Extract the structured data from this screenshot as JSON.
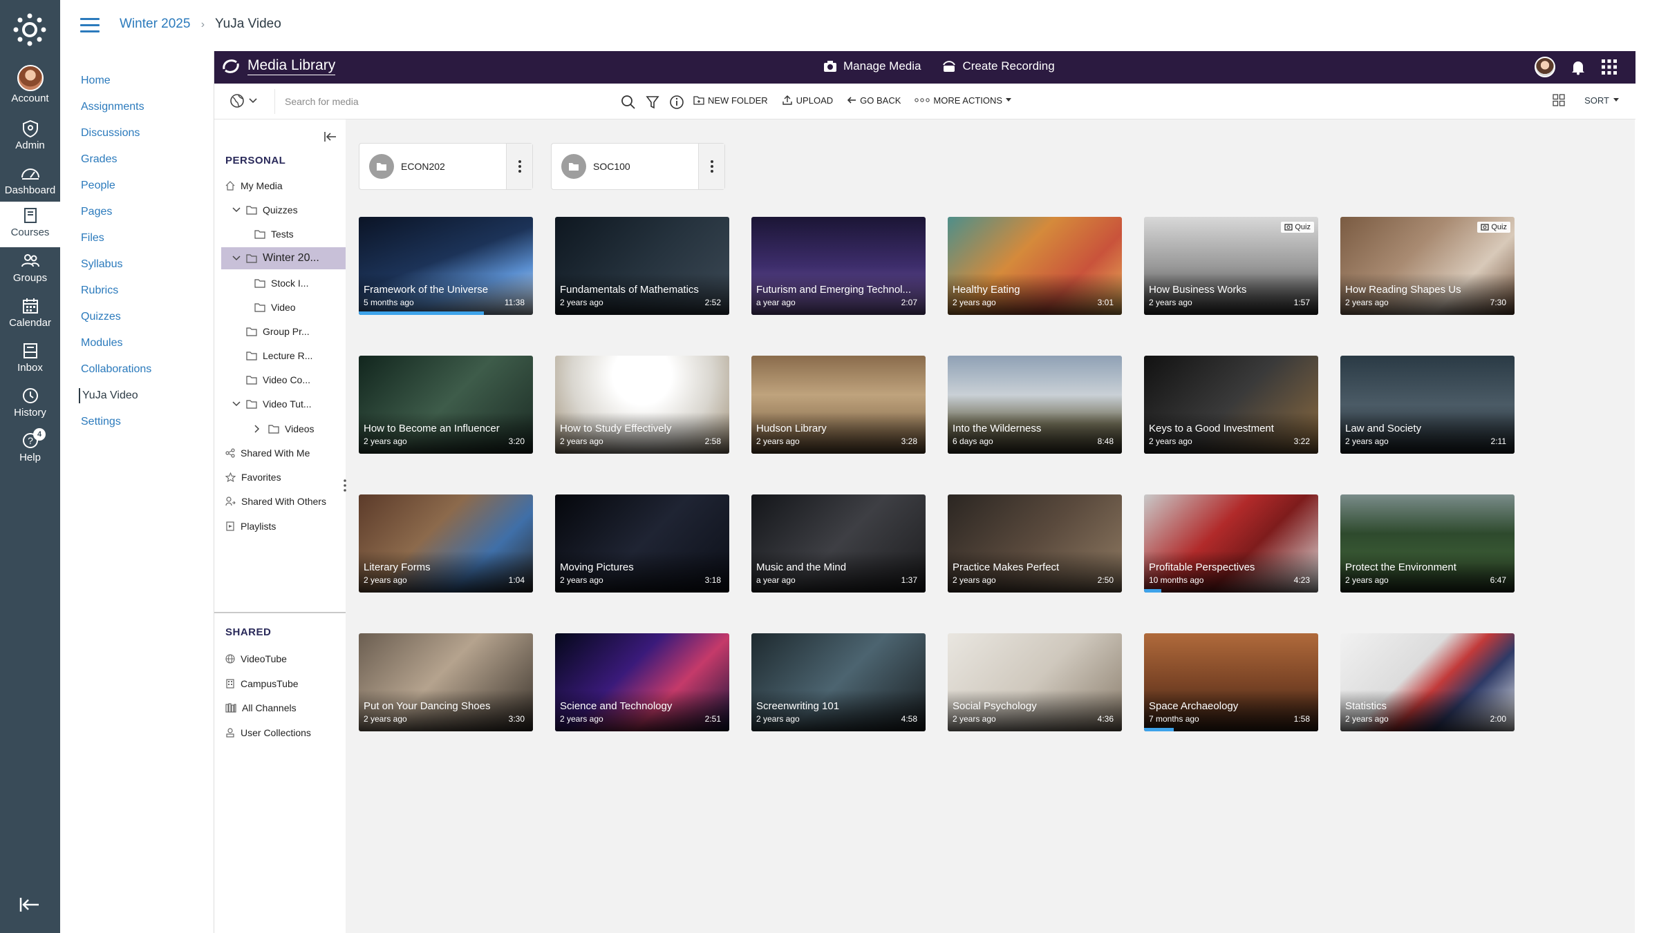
{
  "global_nav": {
    "items": [
      {
        "label": "Account",
        "icon": "account-avatar"
      },
      {
        "label": "Admin",
        "icon": "shield-icon"
      },
      {
        "label": "Dashboard",
        "icon": "dashboard-icon"
      },
      {
        "label": "Courses",
        "icon": "book-icon",
        "active": true
      },
      {
        "label": "Groups",
        "icon": "groups-icon"
      },
      {
        "label": "Calendar",
        "icon": "calendar-icon"
      },
      {
        "label": "Inbox",
        "icon": "inbox-icon"
      },
      {
        "label": "History",
        "icon": "clock-icon"
      },
      {
        "label": "Help",
        "icon": "help-icon",
        "badge": "4"
      }
    ]
  },
  "breadcrumb": {
    "course": "Winter 2025",
    "page": "YuJa Video"
  },
  "course_nav": [
    "Home",
    "Assignments",
    "Discussions",
    "Grades",
    "People",
    "Pages",
    "Files",
    "Syllabus",
    "Rubrics",
    "Quizzes",
    "Modules",
    "Collaborations",
    "YuJa Video",
    "Settings"
  ],
  "course_nav_active": "YuJa Video",
  "yuja": {
    "title": "Media Library",
    "manage_media": "Manage Media",
    "create_recording": "Create Recording",
    "search_placeholder": "Search for media",
    "actions": {
      "new_folder": "NEW FOLDER",
      "upload": "UPLOAD",
      "go_back": "GO BACK",
      "more_actions": "MORE ACTIONS"
    },
    "sort": "SORT",
    "accent_color": "#2b1a40",
    "progress_color": "#3ea3ea"
  },
  "tree": {
    "personal_heading": "PERSONAL",
    "shared_heading": "SHARED",
    "personal": [
      {
        "label": "My Media",
        "icon": "home-icon"
      },
      {
        "label": "Quizzes",
        "icon": "folder-icon",
        "chevron": "down"
      },
      {
        "label": "Tests",
        "icon": "folder-icon"
      },
      {
        "label": "Winter 20...",
        "icon": "folder-icon",
        "chevron": "down",
        "selected": true
      },
      {
        "label": "Stock I...",
        "icon": "folder-icon"
      },
      {
        "label": "Video",
        "icon": "folder-icon"
      },
      {
        "label": "Group Pr...",
        "icon": "folder-icon"
      },
      {
        "label": "Lecture R...",
        "icon": "folder-icon"
      },
      {
        "label": "Video Co...",
        "icon": "folder-icon"
      },
      {
        "label": "Video Tut...",
        "icon": "folder-icon",
        "chevron": "down"
      },
      {
        "label": "Videos",
        "icon": "folder-icon",
        "chevron": "right"
      },
      {
        "label": "Shared With Me",
        "icon": "share-icon"
      },
      {
        "label": "Favorites",
        "icon": "star-icon"
      },
      {
        "label": "Shared With Others",
        "icon": "user-share-icon"
      },
      {
        "label": "Playlists",
        "icon": "playlist-icon"
      }
    ],
    "shared": [
      {
        "label": "VideoTube",
        "icon": "globe-icon"
      },
      {
        "label": "CampusTube",
        "icon": "building-icon"
      },
      {
        "label": "All Channels",
        "icon": "channels-icon"
      },
      {
        "label": "User Collections",
        "icon": "user-collection-icon"
      }
    ]
  },
  "folders": [
    "ECON202",
    "SOC100"
  ],
  "videos": [
    {
      "title": "Framework of the Universe",
      "age": "5 months ago",
      "duration": "11:38",
      "progress": 0.72
    },
    {
      "title": "Fundamentals of Mathematics",
      "age": "2 years ago",
      "duration": "2:52"
    },
    {
      "title": "Futurism and Emerging Technol...",
      "age": "a year ago",
      "duration": "2:07"
    },
    {
      "title": "Healthy Eating",
      "age": "2 years ago",
      "duration": "3:01"
    },
    {
      "title": "How Business Works",
      "age": "2 years ago",
      "duration": "1:57",
      "quiz": "Quiz"
    },
    {
      "title": "How Reading Shapes Us",
      "age": "2 years ago",
      "duration": "7:30",
      "quiz": "Quiz"
    },
    {
      "title": "How to Become an Influencer",
      "age": "2 years ago",
      "duration": "3:20"
    },
    {
      "title": "How to Study Effectively",
      "age": "2 years ago",
      "duration": "2:58"
    },
    {
      "title": "Hudson Library",
      "age": "2 years ago",
      "duration": "3:28"
    },
    {
      "title": "Into the Wilderness",
      "age": "6 days ago",
      "duration": "8:48"
    },
    {
      "title": "Keys to a Good Investment",
      "age": "2 years ago",
      "duration": "3:22"
    },
    {
      "title": "Law and Society",
      "age": "2 years ago",
      "duration": "2:11"
    },
    {
      "title": "Literary Forms",
      "age": "2 years ago",
      "duration": "1:04"
    },
    {
      "title": "Moving Pictures",
      "age": "2 years ago",
      "duration": "3:18"
    },
    {
      "title": "Music and the Mind",
      "age": "a year ago",
      "duration": "1:37"
    },
    {
      "title": "Practice Makes Perfect",
      "age": "2 years ago",
      "duration": "2:50"
    },
    {
      "title": "Profitable Perspectives",
      "age": "10 months ago",
      "duration": "4:23",
      "progress": 0.1
    },
    {
      "title": "Protect the Environment",
      "age": "2 years ago",
      "duration": "6:47"
    },
    {
      "title": "Put on Your Dancing Shoes",
      "age": "2 years ago",
      "duration": "3:30"
    },
    {
      "title": "Science and Technology",
      "age": "2 years ago",
      "duration": "2:51"
    },
    {
      "title": "Screenwriting 101",
      "age": "2 years ago",
      "duration": "4:58"
    },
    {
      "title": "Social Psychology",
      "age": "2 years ago",
      "duration": "4:36"
    },
    {
      "title": "Space Archaeology",
      "age": "7 months ago",
      "duration": "1:58",
      "progress": 0.17
    },
    {
      "title": "Statistics",
      "age": "2 years ago",
      "duration": "2:00"
    }
  ]
}
